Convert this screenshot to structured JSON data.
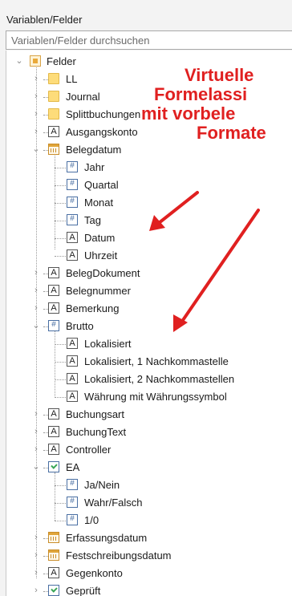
{
  "panel": {
    "title": "Variablen/Felder"
  },
  "search": {
    "placeholder": "Variablen/Felder durchsuchen"
  },
  "tree": {
    "root": "Felder",
    "items": [
      {
        "label": "LL",
        "icon": "folder-icon"
      },
      {
        "label": "Journal",
        "icon": "folder-icon"
      },
      {
        "label": "Splittbuchungen",
        "icon": "folder-icon"
      },
      {
        "label": "Ausgangskonto",
        "icon": "text-field-icon"
      },
      {
        "label": "Belegdatum",
        "icon": "date-field-icon"
      },
      {
        "label": "Jahr",
        "icon": "number-field-icon"
      },
      {
        "label": "Quartal",
        "icon": "number-field-icon"
      },
      {
        "label": "Monat",
        "icon": "number-field-icon"
      },
      {
        "label": "Tag",
        "icon": "number-field-icon"
      },
      {
        "label": "Datum",
        "icon": "text-field-icon"
      },
      {
        "label": "Uhrzeit",
        "icon": "text-field-icon"
      },
      {
        "label": "BelegDokument",
        "icon": "text-field-icon"
      },
      {
        "label": "Belegnummer",
        "icon": "text-field-icon"
      },
      {
        "label": "Bemerkung",
        "icon": "text-field-icon"
      },
      {
        "label": "Brutto",
        "icon": "number-field-icon"
      },
      {
        "label": "Lokalisiert",
        "icon": "text-field-icon"
      },
      {
        "label": "Lokalisiert, 1 Nachkommastelle",
        "icon": "text-field-icon"
      },
      {
        "label": "Lokalisiert, 2 Nachkommastellen",
        "icon": "text-field-icon"
      },
      {
        "label": "Währung mit Währungssymbol",
        "icon": "text-field-icon"
      },
      {
        "label": "Buchungsart",
        "icon": "text-field-icon"
      },
      {
        "label": "BuchungText",
        "icon": "text-field-icon"
      },
      {
        "label": "Controller",
        "icon": "text-field-icon"
      },
      {
        "label": "EA",
        "icon": "boolean-field-icon"
      },
      {
        "label": "Ja/Nein",
        "icon": "number-field-icon"
      },
      {
        "label": "Wahr/Falsch",
        "icon": "number-field-icon"
      },
      {
        "label": "1/0",
        "icon": "number-field-icon"
      },
      {
        "label": "Erfassungsdatum",
        "icon": "date-field-icon"
      },
      {
        "label": "Festschreibungsdatum",
        "icon": "date-field-icon"
      },
      {
        "label": "Gegenkonto",
        "icon": "text-field-icon"
      },
      {
        "label": "Geprüft",
        "icon": "boolean-field-icon"
      }
    ],
    "text_icon_glyph": "A"
  },
  "annotation": {
    "line1": "Virtuelle",
    "line2": "Formelassi",
    "line3": "mit vorbele",
    "line4": "Formate",
    "color": "#e02020"
  }
}
